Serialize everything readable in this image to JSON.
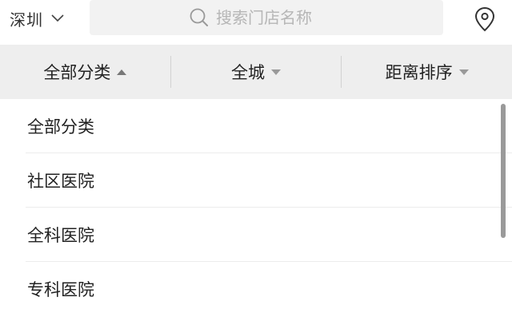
{
  "header": {
    "city": "深圳",
    "search_placeholder": "搜索门店名称"
  },
  "filters": [
    {
      "label": "全部分类",
      "caret": "up",
      "active": true
    },
    {
      "label": "全城",
      "caret": "down",
      "active": false
    },
    {
      "label": "距离排序",
      "caret": "down",
      "active": false
    }
  ],
  "category_list": [
    "全部分类",
    "社区医院",
    "全科医院",
    "专科医院"
  ],
  "icons": {
    "city": "chevron-down-icon",
    "search": "search-icon",
    "location": "location-pin-icon"
  }
}
